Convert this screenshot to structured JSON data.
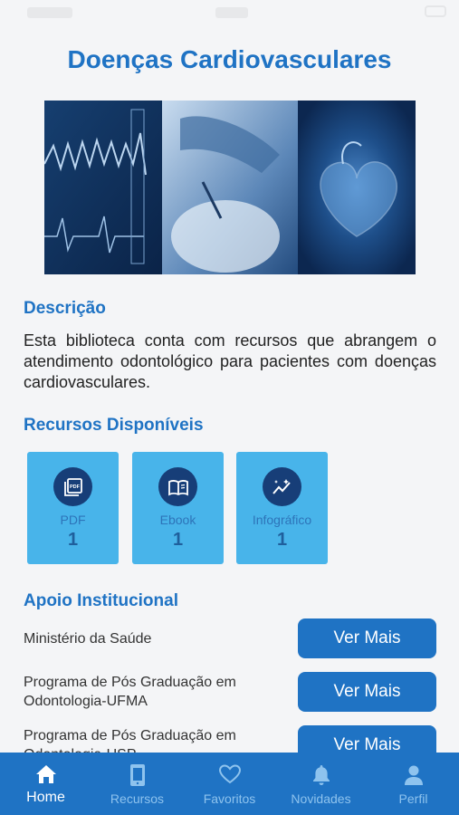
{
  "page": {
    "title": "Doenças Cardiovasculares"
  },
  "descricao": {
    "heading": "Descrição",
    "text": "Esta biblioteca conta com recursos que abrangem o atendimento odontológico para pacientes com doenças cardiovasculares."
  },
  "recursos": {
    "heading": "Recursos Disponíveis",
    "items": [
      {
        "label": "PDF",
        "count": "1",
        "icon": "pdf-icon"
      },
      {
        "label": "Ebook",
        "count": "1",
        "icon": "book-icon"
      },
      {
        "label": "Infográfico",
        "count": "1",
        "icon": "chart-icon"
      }
    ]
  },
  "apoio": {
    "heading": "Apoio Institucional",
    "items": [
      {
        "name": "Ministério da Saúde",
        "button": "Ver Mais"
      },
      {
        "name": "Programa de Pós Graduação em Odontologia-UFMA",
        "button": "Ver Mais"
      },
      {
        "name": "Programa de Pós Graduação em Odontologia-USP",
        "button": "Ver Mais"
      }
    ]
  },
  "tabbar": {
    "active": "Home",
    "items": [
      {
        "label": "Home",
        "icon": "home-icon"
      },
      {
        "label": "Recursos",
        "icon": "tablet-icon"
      },
      {
        "label": "Favoritos",
        "icon": "heart-icon"
      },
      {
        "label": "Novidades",
        "icon": "bell-icon"
      },
      {
        "label": "Perfil",
        "icon": "person-icon"
      }
    ]
  },
  "colors": {
    "primary": "#1f73c4",
    "card": "#48b4ea",
    "icon_circle": "#173e78",
    "background": "#f4f5f7"
  }
}
